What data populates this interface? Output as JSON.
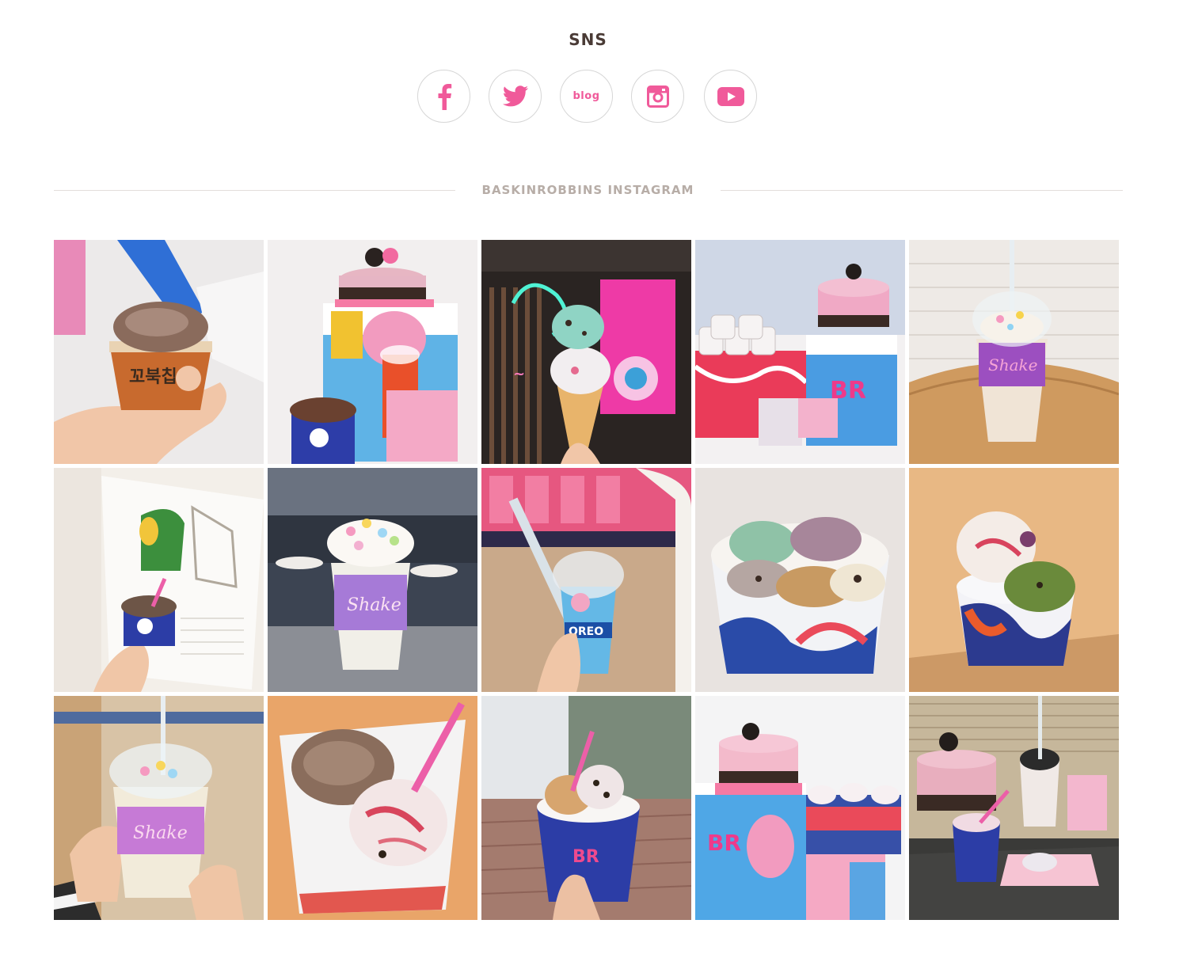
{
  "sns": {
    "title": "SNS",
    "buttons": [
      {
        "id": "facebook",
        "icon": "facebook-icon"
      },
      {
        "id": "twitter",
        "icon": "twitter-icon"
      },
      {
        "id": "blog",
        "icon": "blog-icon",
        "label": "blog"
      },
      {
        "id": "instagram",
        "icon": "instagram-icon"
      },
      {
        "id": "youtube",
        "icon": "youtube-icon"
      }
    ]
  },
  "instagram": {
    "title": "BASKINROBBINS INSTAGRAM",
    "posts": [
      {
        "subject": "hand holding chocolate cookie ice cream cup"
      },
      {
        "subject": "pink panther cake, cooler and ice cream set"
      },
      {
        "subject": "mint chocolate ice cream cone with neon sign"
      },
      {
        "subject": "pink panther cake with mini cups and cooler"
      },
      {
        "subject": "shake with sprinkles and whipped cream"
      },
      {
        "subject": "hand holding ice cream cup near calendar"
      },
      {
        "subject": "marshmallow shake on table"
      },
      {
        "subject": "hand holding pink panther oreo shake"
      },
      {
        "subject": "four-flavor ice cream family cup"
      },
      {
        "subject": "strawberry and green tea ice cream cup"
      },
      {
        "subject": "hand holding marshmallow shake"
      },
      {
        "subject": "chocolate and strawberry ice cream in cup"
      },
      {
        "subject": "hand holding ice cream cup outdoors"
      },
      {
        "subject": "pink panther cake and cooler gift set"
      },
      {
        "subject": "pink panther cake, shake and cup set"
      }
    ]
  },
  "colors": {
    "accent_pink": "#f05a9a",
    "title_dark": "#4a3b36",
    "subtitle_gray": "#b7ada7",
    "circle_border": "#d6d6d6"
  }
}
